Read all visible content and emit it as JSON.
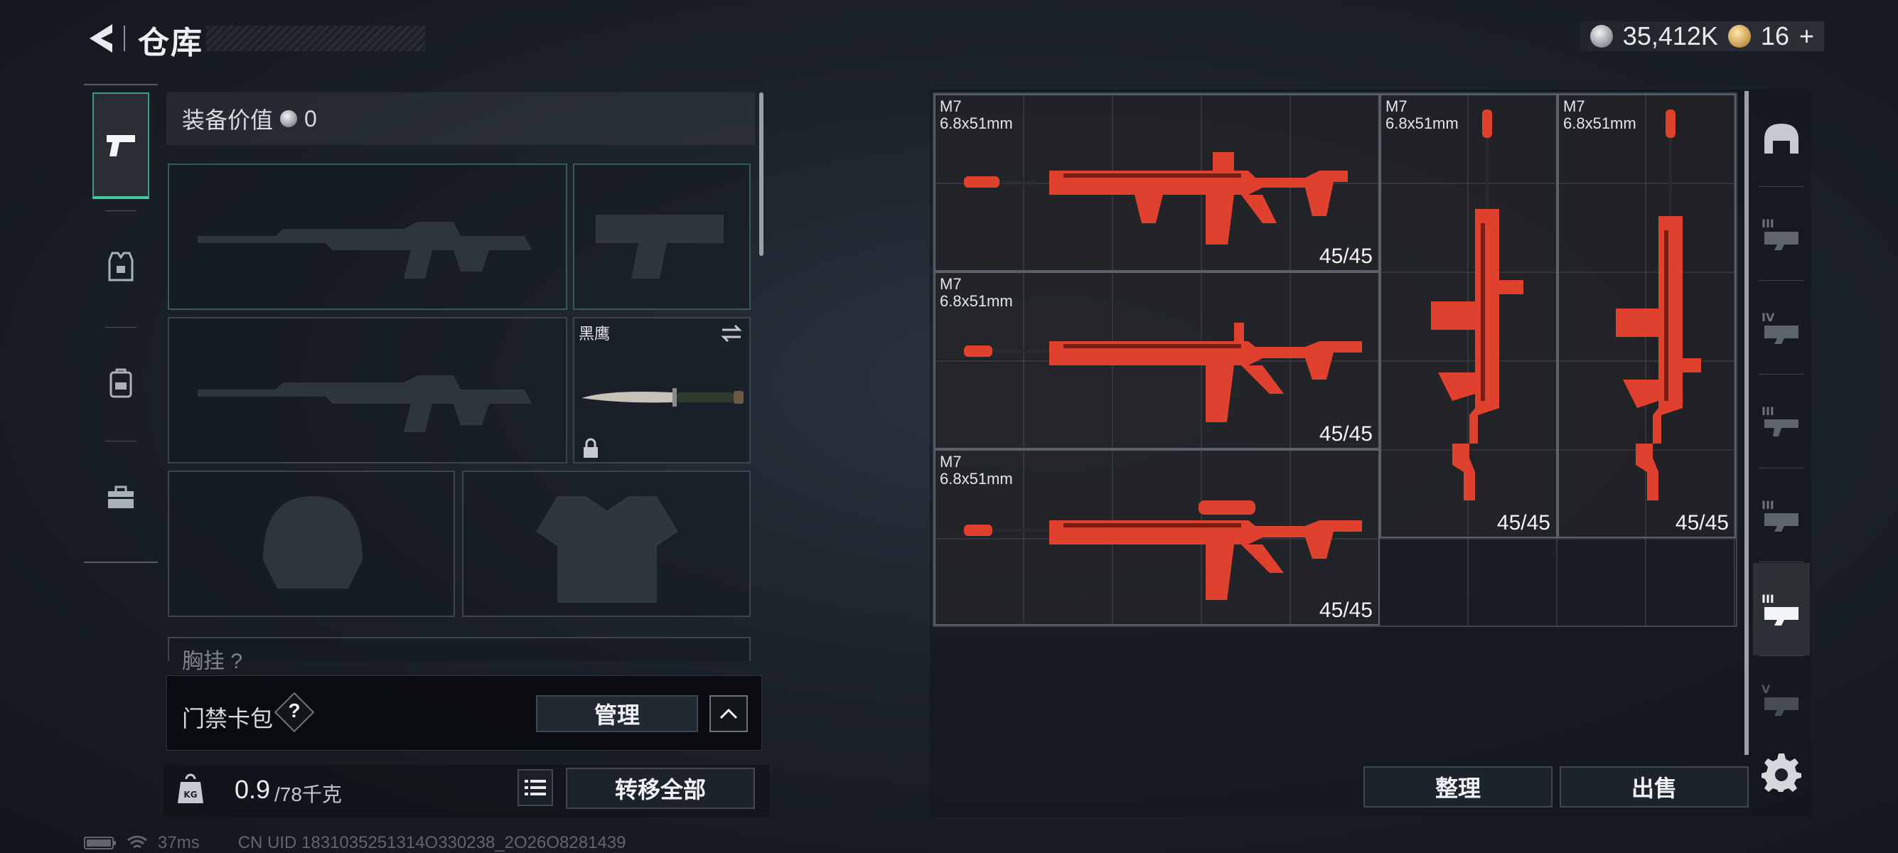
{
  "header": {
    "title": "仓库",
    "back_icon": "back-arrow-icon"
  },
  "currency": {
    "coins": "35,412K",
    "tickets": "16",
    "tickets_add": "+"
  },
  "nav": [
    {
      "name": "weapons",
      "icon": "pistol-icon",
      "active": true
    },
    {
      "name": "armor",
      "icon": "armor-vest-icon",
      "active": false
    },
    {
      "name": "backpack",
      "icon": "backpack-icon",
      "active": false
    },
    {
      "name": "case",
      "icon": "briefcase-icon",
      "active": false
    }
  ],
  "equipment": {
    "value_label": "装备价值",
    "value": "0",
    "melee_name": "黑鹰",
    "chest_label": "胸挂",
    "chest_value": "?"
  },
  "card_pack": {
    "label": "门禁卡包",
    "help": "?",
    "manage_label": "管理"
  },
  "capacity": {
    "current": "0.9",
    "max": "/78千克",
    "icon_text": "KG",
    "transfer_label": "转移全部"
  },
  "status": {
    "ping": "37ms",
    "uid": "CN UID 1831035251314O330238_2O26O8281439"
  },
  "storage": {
    "items": [
      {
        "name": "M7",
        "caliber": "6.8x51mm",
        "ammo": "45/45"
      },
      {
        "name": "M7",
        "caliber": "6.8x51mm",
        "ammo": "45/45"
      },
      {
        "name": "M7",
        "caliber": "6.8x51mm",
        "ammo": "45/45"
      },
      {
        "name": "M7",
        "caliber": "6.8x51mm",
        "ammo": "45/45"
      },
      {
        "name": "M7",
        "caliber": "6.8x51mm",
        "ammo": "45/45"
      }
    ],
    "sort_label": "整理",
    "sell_label": "出售"
  },
  "right_tabs": [
    {
      "icon": "helmet-icon",
      "level": "",
      "active": false
    },
    {
      "icon": "item-grade-3-icon",
      "level": "III",
      "active": false
    },
    {
      "icon": "item-grade-4-icon",
      "level": "IV",
      "active": false
    },
    {
      "icon": "item-grade-3-icon",
      "level": "III",
      "active": false
    },
    {
      "icon": "item-grade-3-icon",
      "level": "III",
      "active": false
    },
    {
      "icon": "item-grade-3-icon",
      "level": "III",
      "active": true
    },
    {
      "icon": "item-grade-5-icon",
      "level": "V",
      "active": false
    }
  ],
  "colors": {
    "accent_teal": "#45c99a",
    "weapon_red": "#e0402e"
  }
}
